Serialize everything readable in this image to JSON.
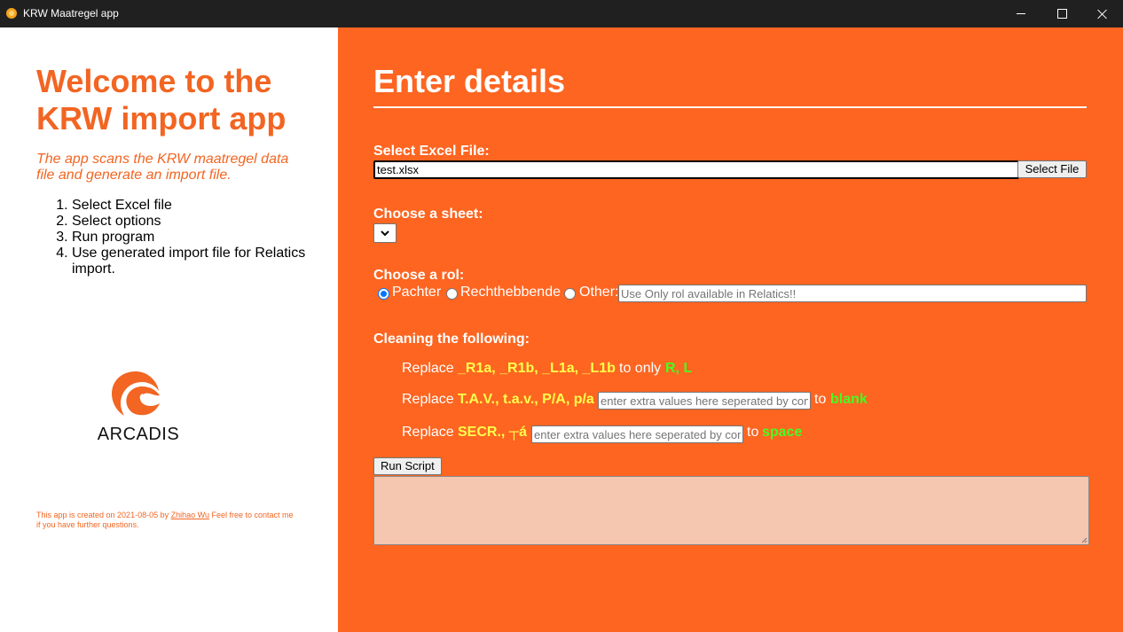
{
  "window": {
    "title": "KRW Maatregel app"
  },
  "left": {
    "welcome": "Welcome to the KRW import app",
    "intro": "The app scans the KRW maatregel data file and generate an import file.",
    "steps": [
      "Select Excel file",
      "Select options",
      "Run program",
      "Use generated import file for Relatics import."
    ],
    "logo_text": "ARCADIS",
    "footnote_before": "This app is created on 2021-08-05 by ",
    "footnote_link": "Zhihao Wu",
    "footnote_after": " Feel free to contact me if you have further questions."
  },
  "right": {
    "heading": "Enter details",
    "excel_label": "Select Excel File:",
    "excel_value": "test.xlsx",
    "select_file_button": "Select File",
    "sheet_label": "Choose a sheet:",
    "sheet_selected": "",
    "rol_label": "Choose a rol:",
    "rol_options": [
      "Pachter",
      "Rechthebbende",
      "Other:"
    ],
    "rol_selected": "Pachter",
    "other_placeholder": "Use Only rol available in Relatics!!",
    "cleaning_label": "Cleaning the following:",
    "replace_word": "Replace",
    "to_word": "to",
    "to_only_word": "to only",
    "rule1_from": "_R1a, _R1b, _L1a, _L1b",
    "rule1_to": "R, L",
    "rule2_from": "T.A.V., t.a.v., P/A, p/a",
    "rule2_placeholder": "enter extra values here seperated by comma",
    "rule2_to": "blank",
    "rule3_from": "SECR., ┬á",
    "rule3_placeholder": "enter extra values here seperated by comma",
    "rule3_to": "space",
    "run_button": "Run Script",
    "output_text": ""
  },
  "colors": {
    "accent": "#fd6521",
    "yellow": "#ffff4d",
    "green": "#44ff22",
    "output_bg": "#f5c6b0"
  }
}
